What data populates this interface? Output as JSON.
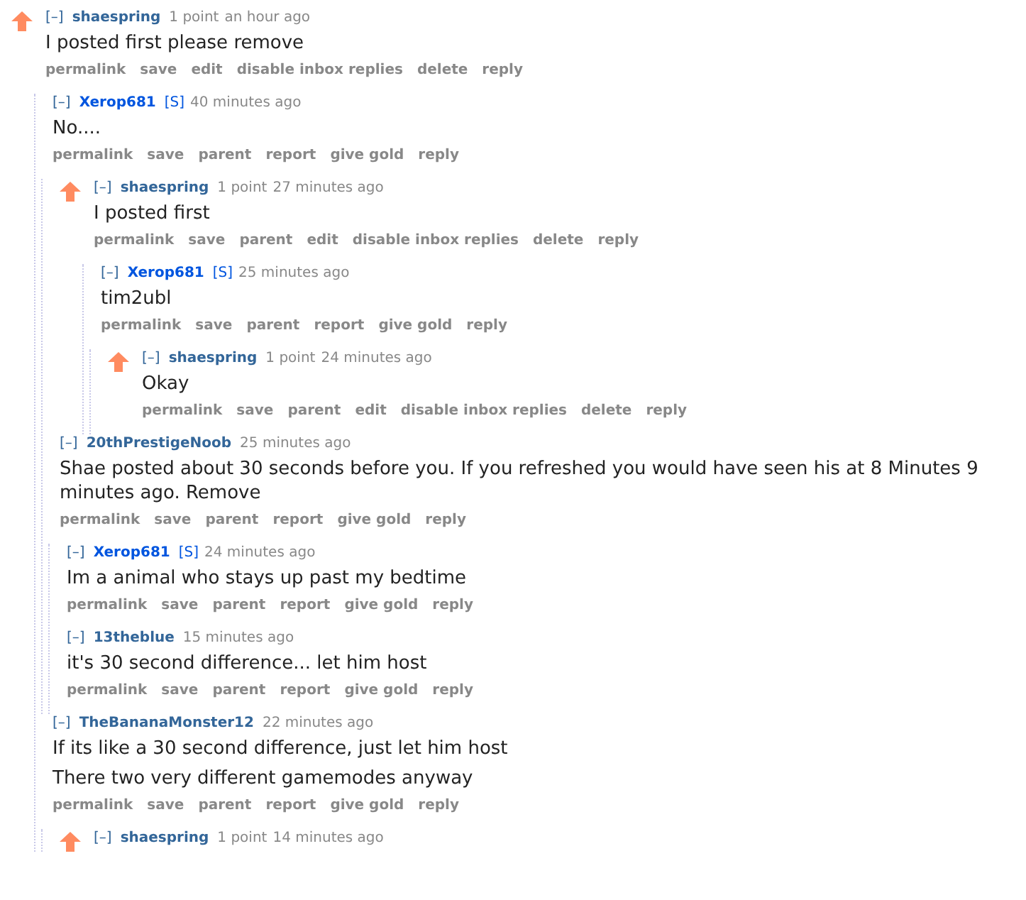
{
  "comments": [
    {
      "toggle": "[–]",
      "author": "shaespring",
      "upvoted": true,
      "score": "1 point",
      "time": "an hour ago",
      "paragraphs": [
        "I posted first please remove"
      ],
      "buttons": [
        "permalink",
        "save",
        "edit",
        "disable inbox replies",
        "delete",
        "reply"
      ],
      "children": [
        {
          "toggle": "[–]",
          "author": "Xerop681",
          "submitter_tag": "[S]",
          "upvoted": false,
          "time": "40 minutes ago",
          "paragraphs": [
            "No...."
          ],
          "buttons": [
            "permalink",
            "save",
            "parent",
            "report",
            "give gold",
            "reply"
          ],
          "children": [
            {
              "toggle": "[–]",
              "author": "shaespring",
              "upvoted": true,
              "score": "1 point",
              "time": "27 minutes ago",
              "paragraphs": [
                "I posted first"
              ],
              "buttons": [
                "permalink",
                "save",
                "parent",
                "edit",
                "disable inbox replies",
                "delete",
                "reply"
              ],
              "children": [
                {
                  "toggle": "[–]",
                  "author": "Xerop681",
                  "submitter_tag": "[S]",
                  "upvoted": false,
                  "time": "25 minutes ago",
                  "paragraphs": [
                    "tim2ubl"
                  ],
                  "buttons": [
                    "permalink",
                    "save",
                    "parent",
                    "report",
                    "give gold",
                    "reply"
                  ],
                  "children": [
                    {
                      "toggle": "[–]",
                      "author": "shaespring",
                      "upvoted": true,
                      "score": "1 point",
                      "time": "24 minutes ago",
                      "paragraphs": [
                        "Okay"
                      ],
                      "buttons": [
                        "permalink",
                        "save",
                        "parent",
                        "edit",
                        "disable inbox replies",
                        "delete",
                        "reply"
                      ]
                    }
                  ]
                }
              ]
            },
            {
              "toggle": "[–]",
              "author": "20thPrestigeNoob",
              "upvoted": false,
              "time": "25 minutes ago",
              "paragraphs": [
                "Shae posted about 30 seconds before you. If you refreshed you would have seen his at 8 Minutes 9 minutes ago. Remove"
              ],
              "buttons": [
                "permalink",
                "save",
                "parent",
                "report",
                "give gold",
                "reply"
              ],
              "children": [
                {
                  "toggle": "[–]",
                  "author": "Xerop681",
                  "submitter_tag": "[S]",
                  "upvoted": false,
                  "time": "24 minutes ago",
                  "paragraphs": [
                    "Im a animal who stays up past my bedtime"
                  ],
                  "buttons": [
                    "permalink",
                    "save",
                    "parent",
                    "report",
                    "give gold",
                    "reply"
                  ]
                },
                {
                  "toggle": "[–]",
                  "author": "13theblue",
                  "upvoted": false,
                  "time": "15 minutes ago",
                  "paragraphs": [
                    "it's 30 second difference... let him host"
                  ],
                  "buttons": [
                    "permalink",
                    "save",
                    "parent",
                    "report",
                    "give gold",
                    "reply"
                  ]
                }
              ]
            }
          ]
        },
        {
          "toggle": "[–]",
          "author": "TheBananaMonster12",
          "upvoted": false,
          "time": "22 minutes ago",
          "paragraphs": [
            "If its like a 30 second difference, just let him host",
            "There two very different gamemodes anyway"
          ],
          "buttons": [
            "permalink",
            "save",
            "parent",
            "report",
            "give gold",
            "reply"
          ],
          "children": [
            {
              "toggle": "[–]",
              "author": "shaespring",
              "upvoted": true,
              "score": "1 point",
              "time": "14 minutes ago"
            }
          ]
        }
      ]
    }
  ]
}
